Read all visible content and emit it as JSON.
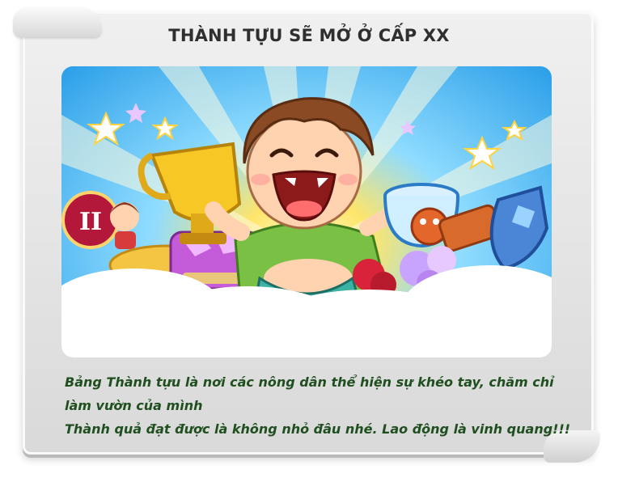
{
  "title": "THÀNH TỰU SẼ MỞ Ở CẤP XX",
  "description": {
    "line1": "Bảng Thành tựu là nơi các nông dân thể hiện sự khéo tay, chăm chỉ",
    "line2": "làm vườn của mình",
    "line3": "Thành quả đạt được là không nhỏ đâu nhé. Lao động là vinh quang!!!"
  },
  "colors": {
    "title": "#2f2f2f",
    "description": "#1f4f1f",
    "scroll": "#e4e4e4"
  }
}
